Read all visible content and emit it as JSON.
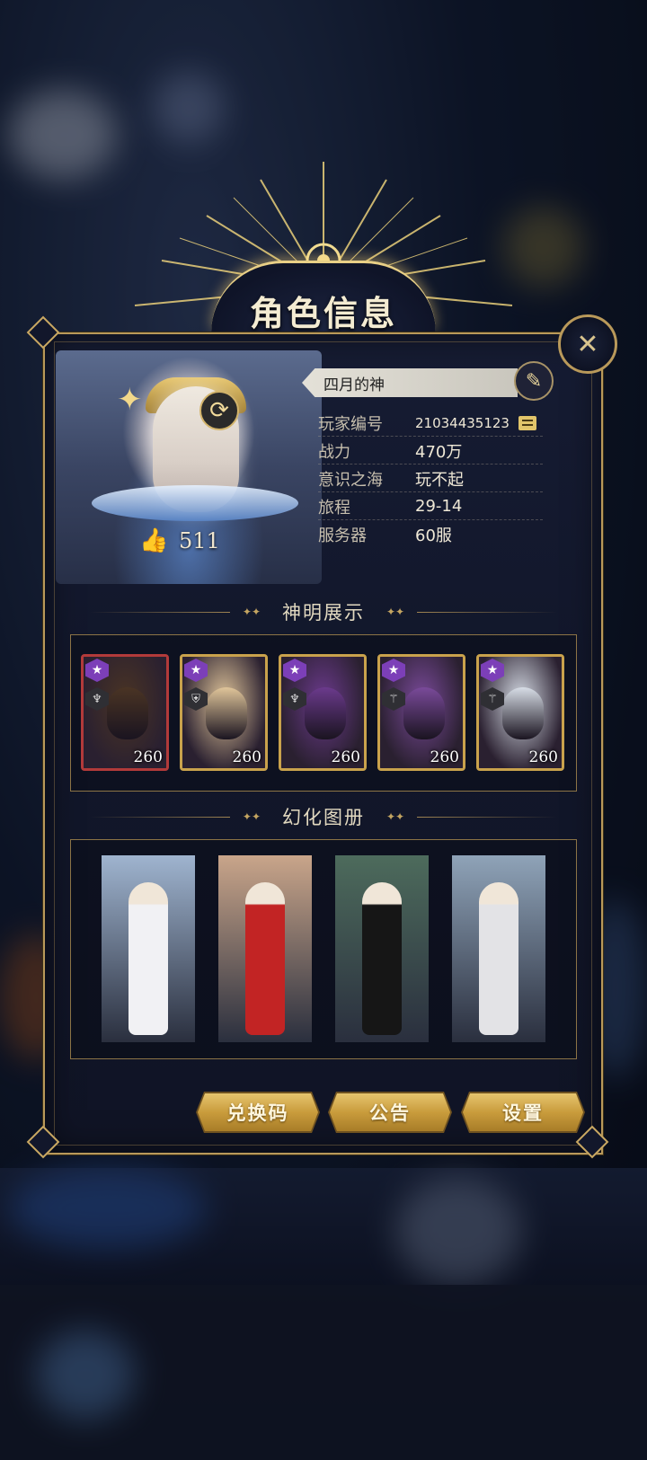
{
  "dialog": {
    "title": "角色信息"
  },
  "profile": {
    "name": "四月的神",
    "likes": "511",
    "rows": [
      {
        "label": "玩家编号",
        "value": "21034435123"
      },
      {
        "label": "战力",
        "value": "470万"
      },
      {
        "label": "意识之海",
        "value": "玩不起"
      },
      {
        "label": "旅程",
        "value": "29-14"
      },
      {
        "label": "服务器",
        "value": "60服"
      }
    ]
  },
  "sections": {
    "heroes_title": "神明展示",
    "skins_title": "幻化图册"
  },
  "heroes": [
    {
      "level": "260",
      "rank_icon": "star-icon",
      "class_icon": "staff-icon",
      "frame": "#b23a3a",
      "color": "#4a3424"
    },
    {
      "level": "260",
      "rank_icon": "star-icon",
      "class_icon": "shield-icon",
      "frame": "#c9a24c",
      "color": "#e0c59a"
    },
    {
      "level": "260",
      "rank_icon": "star-icon",
      "class_icon": "staff-icon",
      "frame": "#c9a24c",
      "color": "#6b3a8c"
    },
    {
      "level": "260",
      "rank_icon": "star-icon",
      "class_icon": "wings-icon",
      "frame": "#c9a24c",
      "color": "#7a4a9a"
    },
    {
      "level": "260",
      "rank_icon": "star-icon",
      "class_icon": "wings-icon",
      "frame": "#c9a24c",
      "color": "#d7dde6"
    }
  ],
  "skins": [
    {
      "theme": "white-gown-mountain",
      "bg": "#9fb4cf",
      "fig": "#f1f1f4"
    },
    {
      "theme": "red-hanfu-palace",
      "bg": "#c9a58a",
      "fig": "#c22424"
    },
    {
      "theme": "teacher-classroom",
      "bg": "#4d6b5c",
      "fig": "#161616"
    },
    {
      "theme": "racing-driver",
      "bg": "#8fa3b8",
      "fig": "#e3e3e6"
    }
  ],
  "buttons": {
    "redeem": "兑换码",
    "notice": "公告",
    "settings": "设置"
  },
  "colors": {
    "gold": "#c9a24c",
    "panel": "#12172b",
    "accent_purple": "#7c3fb8"
  }
}
